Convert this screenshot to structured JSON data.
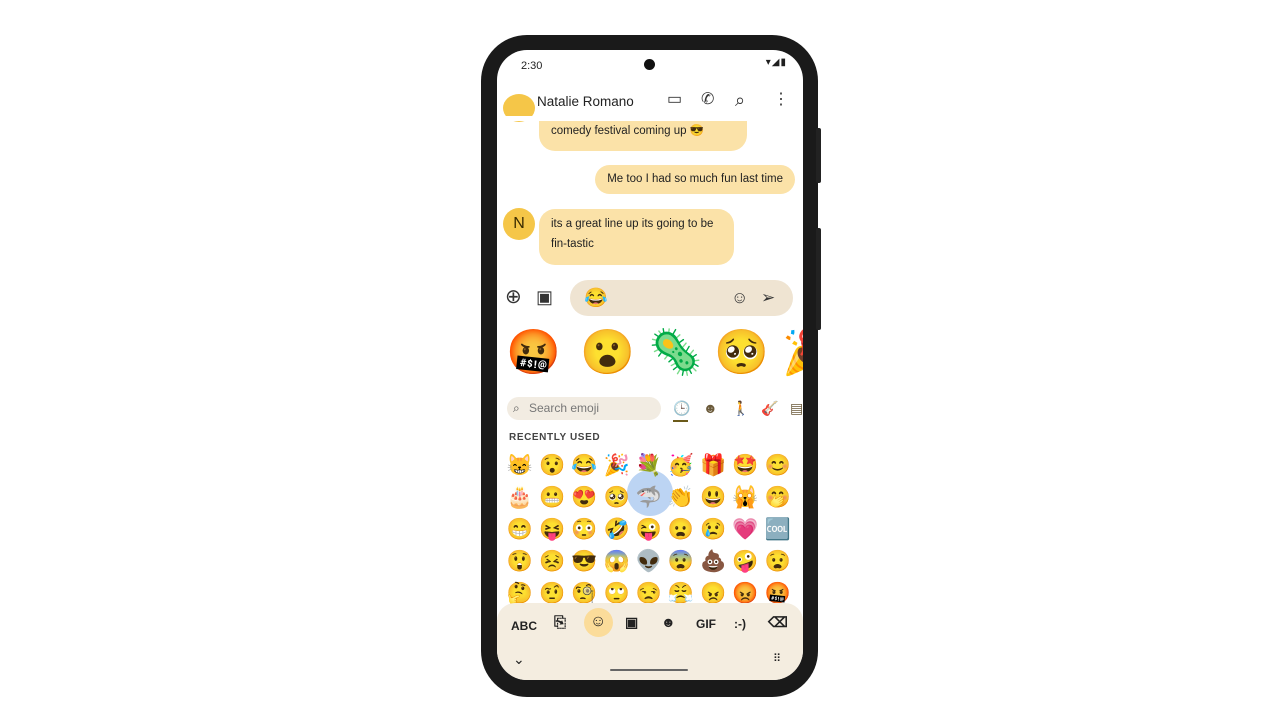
{
  "status": {
    "time": "2:30",
    "icons": "▾◢▮"
  },
  "header": {
    "title": "Natalie Romano",
    "back": "←",
    "video": "▭",
    "call": "✆",
    "search": "⌕",
    "more": "⋮"
  },
  "messages": [
    {
      "from": "Natalie",
      "text": "comedy festival coming up 😎"
    },
    {
      "from": "me",
      "text": "Me too I had so much fun last time"
    },
    {
      "from": "Natalie",
      "avatar": "N",
      "text_lines": [
        "its a great line up its going to be",
        "fin-tastic"
      ]
    }
  ],
  "compose": {
    "value": "😂",
    "add": "⊕",
    "gallery": "▣",
    "emoji_button": "☺",
    "send": "➢"
  },
  "stickers": [
    "🤬",
    "😮",
    "🦠",
    "🥺",
    "🎉"
  ],
  "emoji_panel": {
    "search_placeholder": "Search emoji",
    "categories": [
      {
        "name": "recent",
        "glyph": "🕒",
        "active": true
      },
      {
        "name": "smileys",
        "glyph": "☻"
      },
      {
        "name": "people",
        "glyph": "🚶"
      },
      {
        "name": "activities",
        "glyph": "🎸"
      },
      {
        "name": "objects",
        "glyph": "▤"
      }
    ],
    "section_label": "RECENTLY USED",
    "highlighted": "🦈",
    "rows": [
      [
        "😸",
        "😯",
        "😂",
        "🎉",
        "💐",
        "🥳",
        "🎁",
        "🤩",
        "😊"
      ],
      [
        "🎂",
        "😬",
        "😍",
        "🥺",
        "🦈",
        "👏",
        "😃",
        "🙀",
        "🤭"
      ],
      [
        "😁",
        "😝",
        "😳",
        "🤣",
        "😜",
        "😦",
        "😢",
        "💗",
        "🆒"
      ],
      [
        "😲",
        "😣",
        "😎",
        "😱",
        "👽",
        "😨",
        "💩",
        "🤪",
        "😧"
      ],
      [
        "🤔",
        "🤨",
        "🧐",
        "🙄",
        "😒",
        "😤",
        "😠",
        "😡",
        "🤬"
      ]
    ]
  },
  "keyboard": {
    "abc": "ABC",
    "clipboard": "⎘",
    "emoji": "☺",
    "sticker": "▣",
    "emoticon_sticker": "☻",
    "gif": "GIF",
    "emoticon": ":-)",
    "backspace": "⌫",
    "collapse": "⌄",
    "keyboard_switch": "⠿"
  }
}
